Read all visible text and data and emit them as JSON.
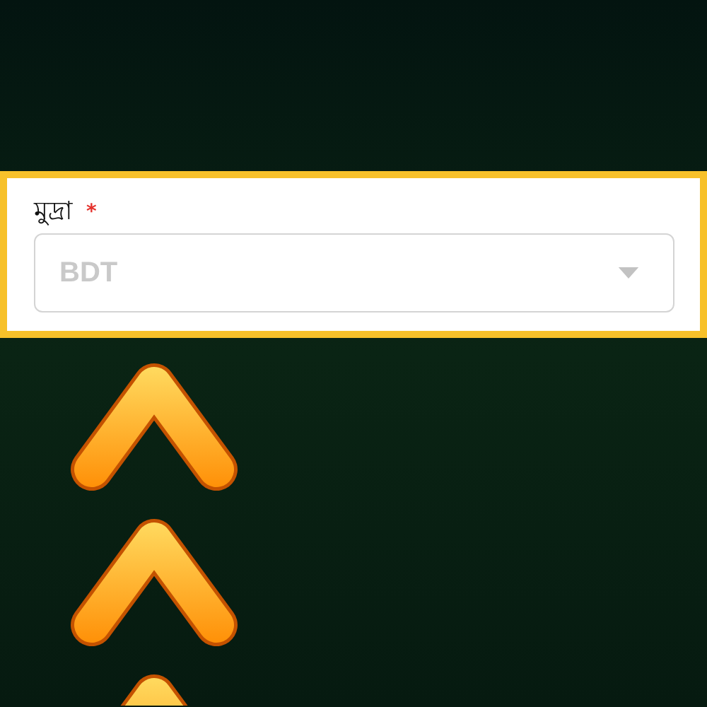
{
  "currency_field": {
    "label": "মুদ্রা",
    "required": true,
    "required_mark": "*",
    "value": "BDT",
    "disabled": true
  }
}
